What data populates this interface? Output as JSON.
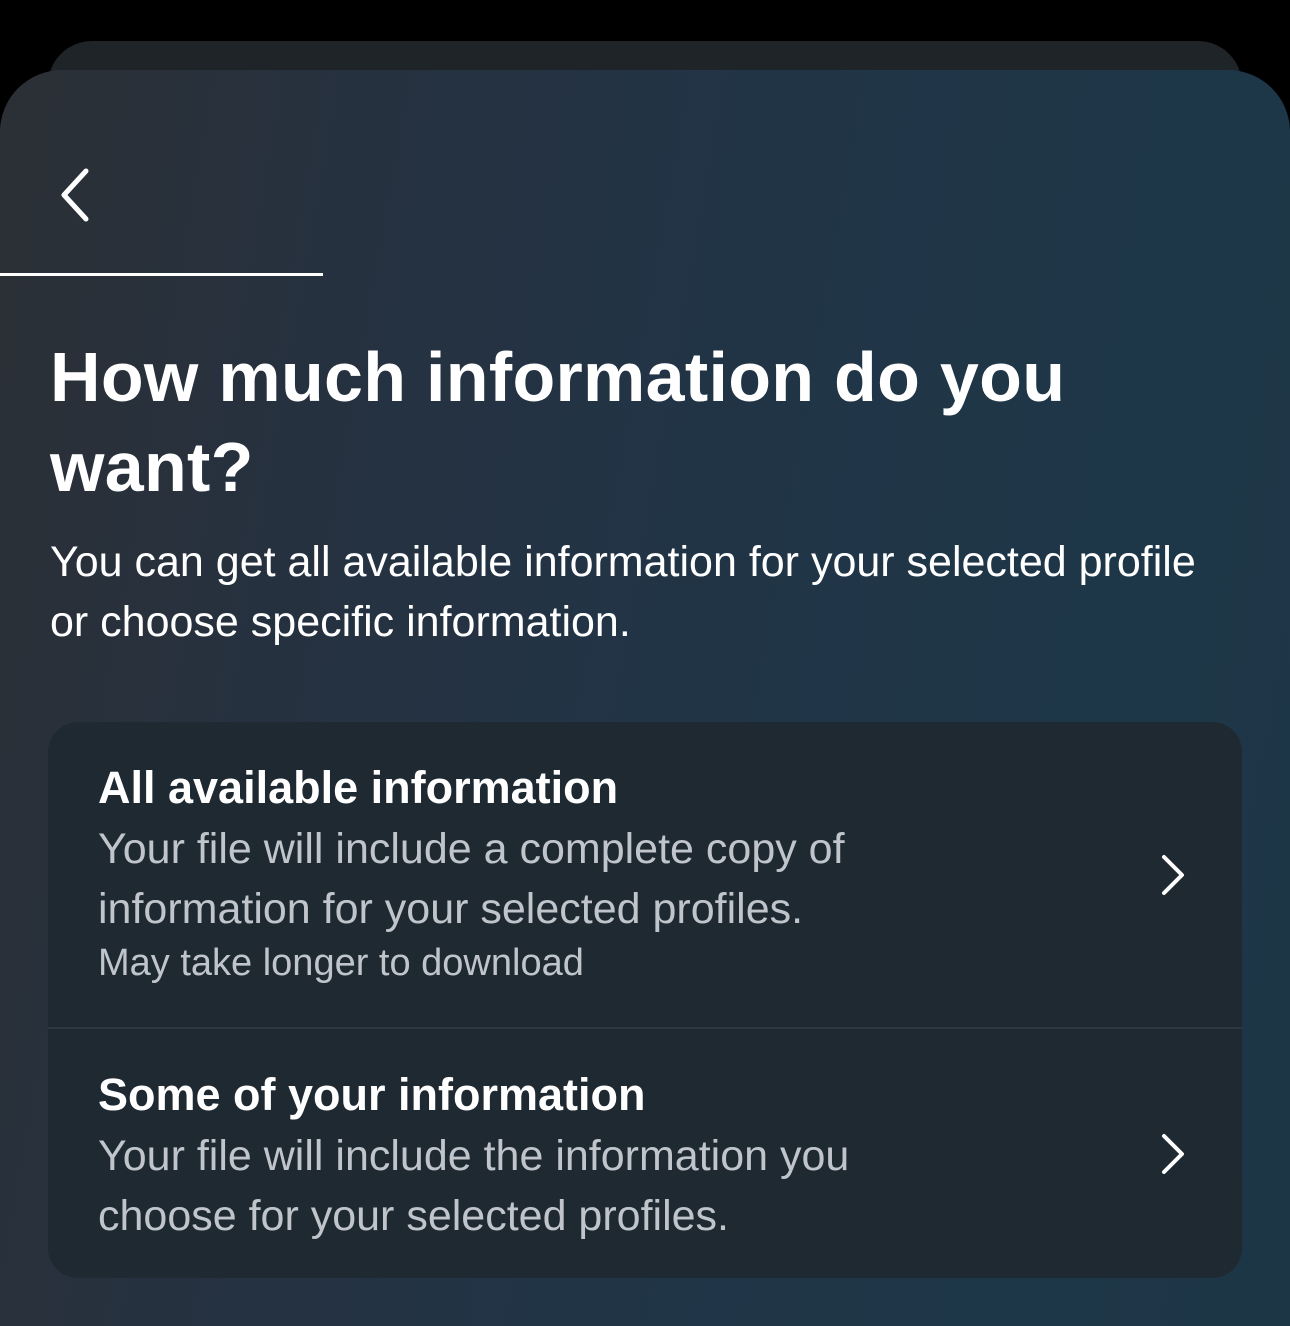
{
  "progress": {
    "value_fraction": 0.25
  },
  "header": {
    "back_icon": "chevron-left-icon",
    "title": "How much information do you want?",
    "subtitle": "You can get all available information for your selected profile or choose specific information."
  },
  "options": [
    {
      "title": "All available information",
      "description": "Your file will include a complete copy of information for your selected profiles.",
      "note": "May take longer to download",
      "icon": "chevron-right-icon"
    },
    {
      "title": "Some of your information",
      "description": "Your file will include the information you choose for your selected profiles.",
      "icon": "chevron-right-icon"
    }
  ],
  "colors": {
    "text_primary": "#ffffff",
    "text_secondary": "#c0c5cb",
    "card_background": "#1f2931",
    "progress_fill": "#ffffff"
  }
}
